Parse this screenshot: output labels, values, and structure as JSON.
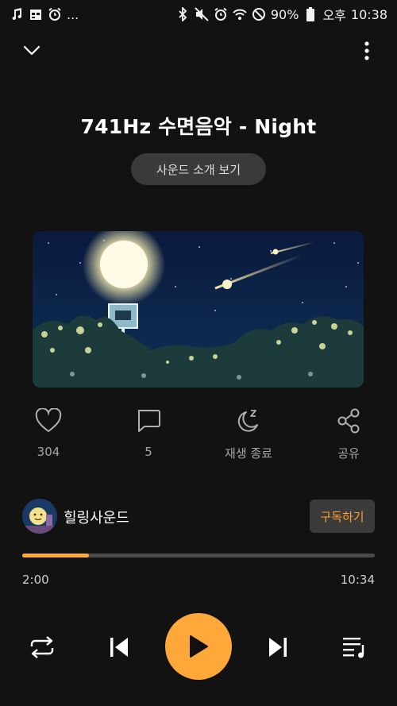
{
  "status_bar": {
    "left_icons": [
      "music-note-icon",
      "calendar-icon",
      "alarm-icon"
    ],
    "more_indicator": "...",
    "right_icons": [
      "bluetooth-icon",
      "mute-icon",
      "alarm-clock-icon",
      "wifi-icon",
      "do-not-disturb-icon"
    ],
    "battery": "90%",
    "ampm": "오후",
    "time": "10:38"
  },
  "player": {
    "title": "741Hz 수면음악 - Night",
    "intro_label": "사운드 소개 보기",
    "actions": {
      "like_count": "304",
      "comment_count": "5",
      "sleep_timer_label": "재생 종료",
      "share_label": "공유"
    },
    "channel": {
      "name": "힐링사운드",
      "subscribe_label": "구독하기"
    },
    "progress": {
      "elapsed": "2:00",
      "total": "10:34",
      "fraction": 0.19
    }
  },
  "colors": {
    "accent": "#ffa83a",
    "background": "#121212",
    "chip": "#3a3a3a"
  }
}
